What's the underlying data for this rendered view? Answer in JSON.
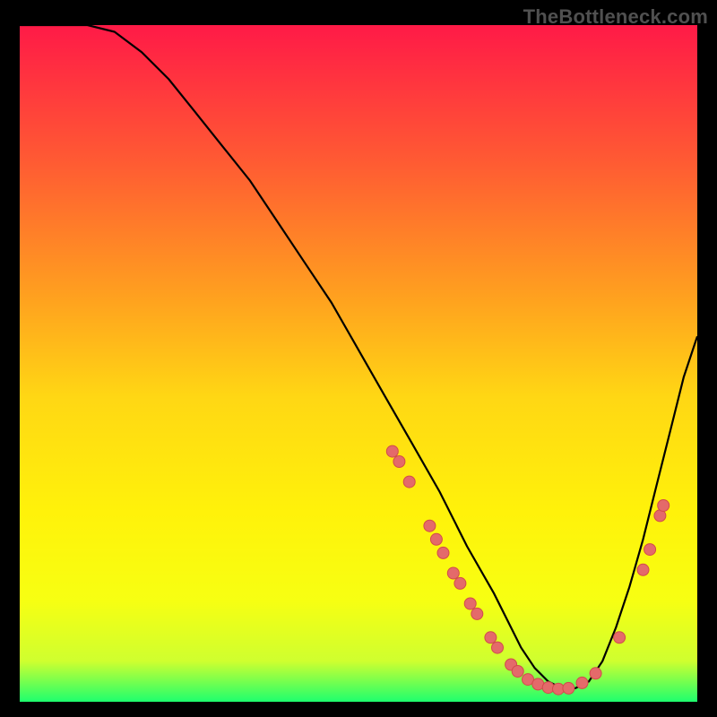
{
  "watermark": "TheBottleneck.com",
  "gradient_colors": {
    "c0": "#ff1a47",
    "c20": "#ff5a33",
    "c40": "#ffa01f",
    "c55": "#ffd714",
    "c72": "#fff20a",
    "c85": "#f7ff12",
    "c94": "#cfff2f",
    "c100": "#1eff6e"
  },
  "curve_color": "#000000",
  "dot_fill": "#e46a6a",
  "dot_stroke": "#d24b4b",
  "chart_data": {
    "type": "line",
    "title": "",
    "xlabel": "",
    "ylabel": "",
    "xlim": [
      0,
      100
    ],
    "ylim": [
      0,
      100
    ],
    "series": [
      {
        "name": "curve",
        "x": [
          0,
          3,
          6,
          10,
          14,
          18,
          22,
          26,
          30,
          34,
          38,
          42,
          46,
          50,
          54,
          58,
          62,
          66,
          70,
          72,
          74,
          76,
          78,
          80,
          82,
          84,
          86,
          88,
          90,
          92,
          94,
          96,
          98,
          100
        ],
        "y": [
          100,
          100,
          100,
          100,
          99,
          96,
          92,
          87,
          82,
          77,
          71,
          65,
          59,
          52,
          45,
          38,
          31,
          23,
          16,
          12,
          8,
          5,
          3,
          2,
          2,
          3,
          6,
          11,
          17,
          24,
          32,
          40,
          48,
          54
        ]
      }
    ],
    "markers": [
      {
        "x": 55.0,
        "y": 37.0
      },
      {
        "x": 56.0,
        "y": 35.5
      },
      {
        "x": 57.5,
        "y": 32.5
      },
      {
        "x": 60.5,
        "y": 26.0
      },
      {
        "x": 61.5,
        "y": 24.0
      },
      {
        "x": 62.5,
        "y": 22.0
      },
      {
        "x": 64.0,
        "y": 19.0
      },
      {
        "x": 65.0,
        "y": 17.5
      },
      {
        "x": 66.5,
        "y": 14.5
      },
      {
        "x": 67.5,
        "y": 13.0
      },
      {
        "x": 69.5,
        "y": 9.5
      },
      {
        "x": 70.5,
        "y": 8.0
      },
      {
        "x": 72.5,
        "y": 5.5
      },
      {
        "x": 73.5,
        "y": 4.5
      },
      {
        "x": 75.0,
        "y": 3.3
      },
      {
        "x": 76.5,
        "y": 2.6
      },
      {
        "x": 78.0,
        "y": 2.1
      },
      {
        "x": 79.5,
        "y": 1.9
      },
      {
        "x": 81.0,
        "y": 2.0
      },
      {
        "x": 83.0,
        "y": 2.8
      },
      {
        "x": 85.0,
        "y": 4.2
      },
      {
        "x": 88.5,
        "y": 9.5
      },
      {
        "x": 92.0,
        "y": 19.5
      },
      {
        "x": 93.0,
        "y": 22.5
      },
      {
        "x": 94.5,
        "y": 27.5
      },
      {
        "x": 95.0,
        "y": 29.0
      }
    ]
  }
}
